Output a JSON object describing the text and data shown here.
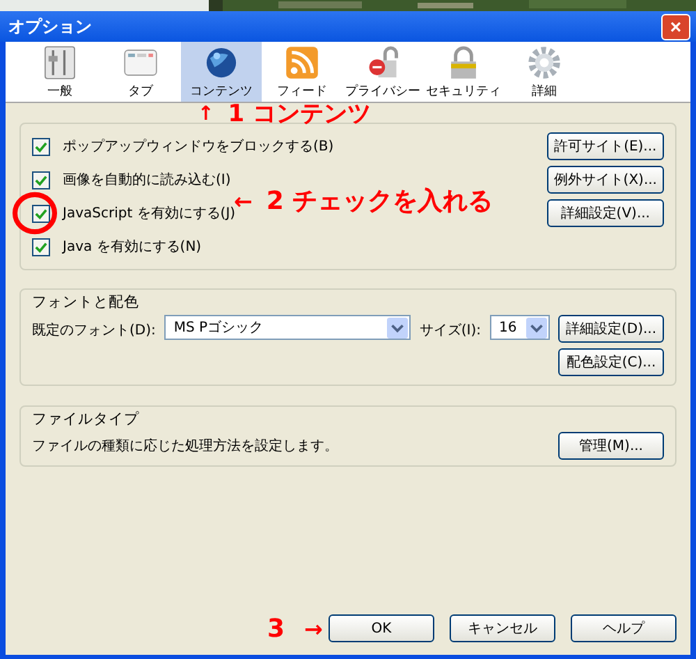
{
  "window": {
    "title": "オプション",
    "close": "×"
  },
  "tabs": [
    {
      "label": "一般",
      "selected": false,
      "kind": "sliders"
    },
    {
      "label": "タブ",
      "selected": false,
      "kind": "tabs"
    },
    {
      "label": "コンテンツ",
      "selected": true,
      "kind": "globe"
    },
    {
      "label": "フィード",
      "selected": false,
      "kind": "feed"
    },
    {
      "label": "プライバシー",
      "selected": false,
      "kind": "lock-open"
    },
    {
      "label": "セキュリティ",
      "selected": false,
      "kind": "lock"
    },
    {
      "label": "詳細",
      "selected": false,
      "kind": "gear"
    }
  ],
  "content": {
    "checkboxes": [
      {
        "label": "ポップアップウィンドウをブロックする(B)",
        "checked": true
      },
      {
        "label": "画像を自動的に読み込む(I)",
        "checked": true
      },
      {
        "label": "JavaScript を有効にする(J)",
        "checked": true
      },
      {
        "label": "Java を有効にする(N)",
        "checked": true
      }
    ],
    "buttons": [
      "許可サイト(E)...",
      "例外サイト(X)...",
      "詳細設定(V)..."
    ]
  },
  "fonts": {
    "title": "フォントと配色",
    "font_label": "既定のフォント(D):",
    "font_value": "MS Pゴシック",
    "size_label": "サイズ(I):",
    "size_value": "16",
    "buttons": [
      "詳細設定(D)...",
      "配色設定(C)..."
    ]
  },
  "file_types": {
    "title": "ファイルタイプ",
    "description": "ファイルの種類に応じた処理方法を設定します。",
    "button": "管理(M)..."
  },
  "dialog_buttons": [
    "OK",
    "キャンセル",
    "ヘルプ"
  ],
  "annotations": [
    {
      "arrow": "↑",
      "text": "1 コンテンツ"
    },
    {
      "arrow": "←",
      "text": "2 チェックを入れる"
    },
    {
      "arrow": "→",
      "text": "3"
    }
  ]
}
